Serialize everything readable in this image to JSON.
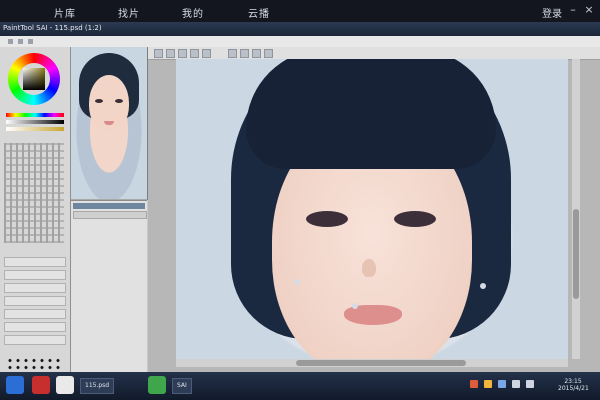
{
  "topnav": {
    "items": [
      "片库",
      "找片",
      "我的",
      "云播"
    ],
    "login_label": "登录"
  },
  "window": {
    "title": "PaintTool SAI - 115.psd (1:2)"
  },
  "taskbar": {
    "tasks": [
      "115.psd",
      "SAI"
    ],
    "clock_time": "23:15",
    "clock_date": "2015/4/21"
  },
  "colors": {
    "bg": "#0d0f16",
    "topbar": "#13161e",
    "app_chrome": "#c9c9c9",
    "accent_titlebar": "#1b2638"
  },
  "icons": {
    "minimize": "minus-icon",
    "close": "close-icon"
  }
}
